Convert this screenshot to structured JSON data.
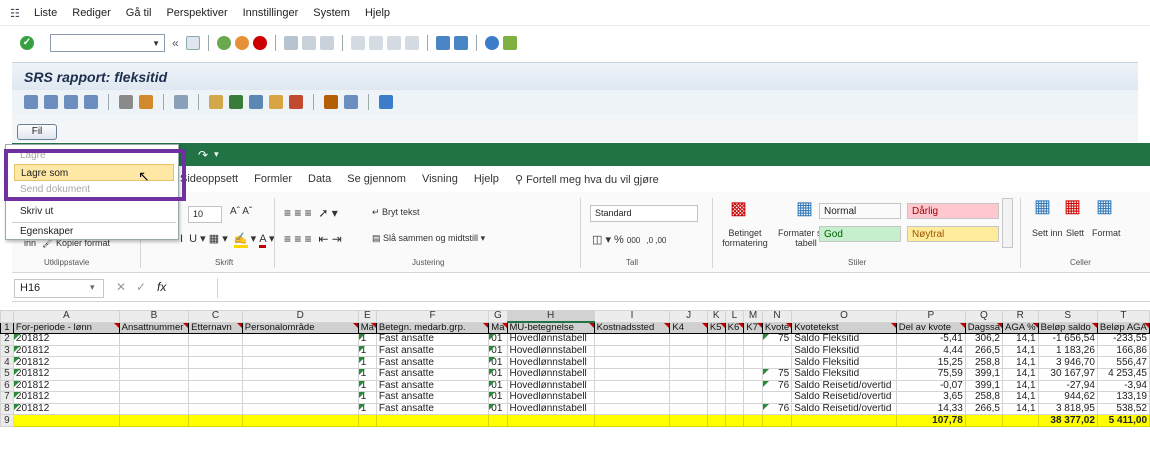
{
  "sap": {
    "menu": [
      "Liste",
      "Rediger",
      "Gå til",
      "Perspektiver",
      "Innstillinger",
      "System",
      "Hjelp"
    ],
    "title": "SRS rapport: fleksitid",
    "fil_button": "Fil",
    "cmd_field_value": ""
  },
  "file_menu": {
    "items": [
      {
        "label": "Lagre",
        "disabled": true
      },
      {
        "label": "Lagre som",
        "disabled": false
      },
      {
        "label": "Send dokument",
        "disabled": true
      },
      {
        "label": "Skriv ut",
        "disabled": false
      },
      {
        "label": "Egenskaper",
        "disabled": false
      }
    ]
  },
  "excel": {
    "tabs": [
      "Sideoppsett",
      "Formler",
      "Data",
      "Se gjennom",
      "Visning",
      "Hjelp",
      "Fortell meg hva du vil gjøre"
    ],
    "ribbon": {
      "font_size": "10",
      "wrap_text": "Bryt tekst",
      "merge": "Slå sammen og midtstill",
      "number_format": "Standard",
      "cond_format": "Betinget formatering",
      "format_table": "Formater som tabell",
      "insert": "Sett inn",
      "delete": "Slett",
      "format": "Format",
      "copy_format": "Kopier format",
      "insert_small": "inn",
      "groups": [
        "Utklippstavle",
        "Skrift",
        "Justering",
        "Tall",
        "Stiler",
        "Celler"
      ],
      "styles": [
        {
          "label": "Normal",
          "bg": "#ffffff",
          "fg": "#000000"
        },
        {
          "label": "Dårlig",
          "bg": "#ffc7ce",
          "fg": "#9c0006"
        },
        {
          "label": "God",
          "bg": "#c6efce",
          "fg": "#006100"
        },
        {
          "label": "Nøytral",
          "bg": "#ffeb9c",
          "fg": "#9c5700"
        }
      ]
    },
    "name_box": "H16",
    "fx": "fx",
    "columns": [
      "A",
      "B",
      "C",
      "D",
      "E",
      "F",
      "G",
      "H",
      "I",
      "J",
      "K",
      "L",
      "M",
      "N",
      "O",
      "P",
      "Q",
      "R",
      "S",
      "T"
    ],
    "header": [
      "For-periode - lønn",
      "Ansattnummer",
      "Etternavn",
      "Personalområde",
      "Ma",
      "Betegn. medarb.grp.",
      "Ma",
      "MU-betegnelse",
      "Kostnadssted",
      "K4",
      "K5",
      "K6",
      "K7",
      "Kvote",
      "Kvotetekst",
      "Del av kvote",
      "Dagssa",
      "AGA %",
      "Beløp saldo",
      "Beløp AGA"
    ],
    "rows": [
      [
        "201812",
        "",
        "",
        "",
        "1",
        "Fast ansatte",
        "01",
        "Hovedlønnstabell",
        "",
        "",
        "",
        "",
        "",
        "75",
        "Saldo Fleksitid",
        "-5,41",
        "306,2",
        "14,1",
        "-1 656,54",
        "-233,55"
      ],
      [
        "201812",
        "",
        "",
        "",
        "1",
        "Fast ansatte",
        "01",
        "Hovedlønnstabell",
        "",
        "",
        "",
        "",
        "",
        "",
        "Saldo Fleksitid",
        "4,44",
        "266,5",
        "14,1",
        "1 183,26",
        "166,86"
      ],
      [
        "201812",
        "",
        "",
        "",
        "1",
        "Fast ansatte",
        "01",
        "Hovedlønnstabell",
        "",
        "",
        "",
        "",
        "",
        "",
        "Saldo Fleksitid",
        "15,25",
        "258,8",
        "14,1",
        "3 946,70",
        "556,47"
      ],
      [
        "201812",
        "",
        "",
        "",
        "1",
        "Fast ansatte",
        "01",
        "Hovedlønnstabell",
        "",
        "",
        "",
        "",
        "",
        "75",
        "Saldo Fleksitid",
        "75,59",
        "399,1",
        "14,1",
        "30 167,97",
        "4 253,45"
      ],
      [
        "201812",
        "",
        "",
        "",
        "1",
        "Fast ansatte",
        "01",
        "Hovedlønnstabell",
        "",
        "",
        "",
        "",
        "",
        "76",
        "Saldo Reisetid/overtid",
        "-0,07",
        "399,1",
        "14,1",
        "-27,94",
        "-3,94"
      ],
      [
        "201812",
        "",
        "",
        "",
        "1",
        "Fast ansatte",
        "01",
        "Hovedlønnstabell",
        "",
        "",
        "",
        "",
        "",
        "",
        "Saldo Reisetid/overtid",
        "3,65",
        "258,8",
        "14,1",
        "944,62",
        "133,19"
      ],
      [
        "201812",
        "",
        "",
        "",
        "1",
        "Fast ansatte",
        "01",
        "Hovedlønnstabell",
        "",
        "",
        "",
        "",
        "",
        "76",
        "Saldo Reisetid/overtid",
        "14,33",
        "266,5",
        "14,1",
        "3 818,95",
        "538,52"
      ]
    ],
    "totals": {
      "del_av_kvote": "107,78",
      "belop_saldo": "38 377,02",
      "belop_aga": "5 411,00"
    }
  }
}
